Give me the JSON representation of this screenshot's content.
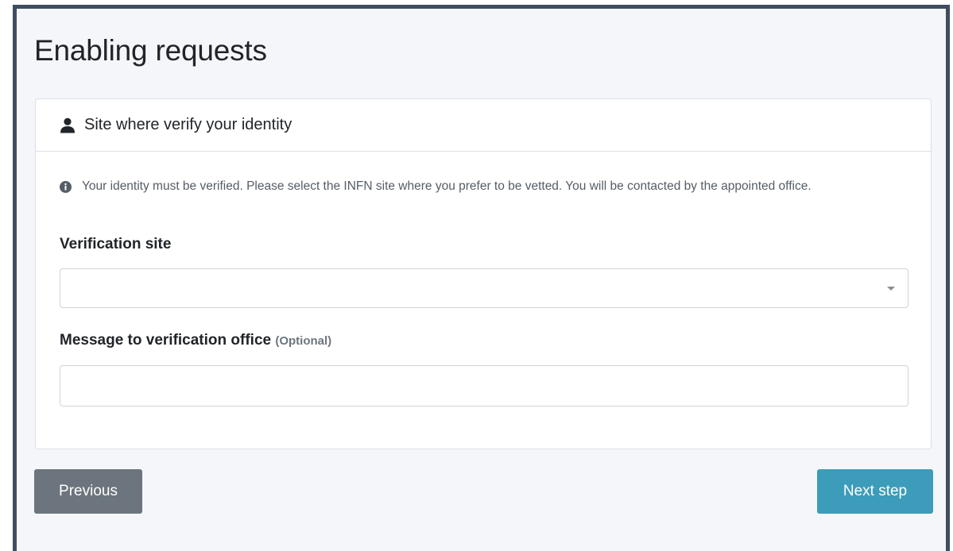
{
  "page": {
    "title": "Enabling requests"
  },
  "card": {
    "title": "Site where verify your identity",
    "header_icon": "user-icon",
    "info_icon": "info-circle-icon",
    "info_text": "Your identity must be verified. Please select the INFN site where you prefer to be vetted. You will be contacted by the appointed office.",
    "verification_site_label": "Verification site",
    "verification_site_value": "",
    "message_label": "Message to verification office",
    "message_optional": "(Optional)",
    "message_value": ""
  },
  "buttons": {
    "previous": "Previous",
    "next": "Next step"
  },
  "colors": {
    "frame_border": "#3e4e60",
    "page_background": "#f4f6fa",
    "previous_button": "#6c757d",
    "next_button": "#3c9cba"
  }
}
